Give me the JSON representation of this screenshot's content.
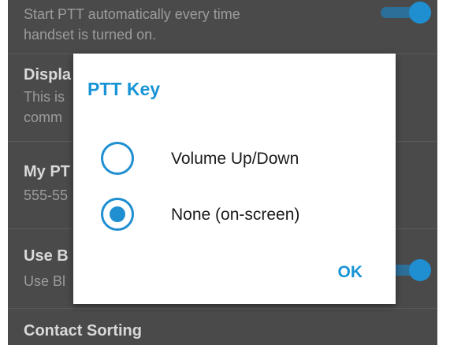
{
  "settings": {
    "auto_start": {
      "summary_line1": "Start PTT automatically every time",
      "summary_line2": "handset is turned on."
    },
    "display": {
      "title": "Displa",
      "summary_line1": "This is",
      "summary_line2": "comm"
    },
    "my_ptt": {
      "title": "My PT",
      "summary": "555-55"
    },
    "use_bluetooth": {
      "title": "Use B",
      "summary": "Use Bl"
    },
    "contact_sorting": {
      "title": "Contact Sorting"
    }
  },
  "dialog": {
    "title": "PTT Key",
    "options": [
      {
        "label": "Volume Up/Down",
        "selected": false
      },
      {
        "label": "None (on-screen)",
        "selected": true
      }
    ],
    "ok_label": "OK"
  },
  "colors": {
    "accent": "#1f8fd1",
    "background": "#4a4a4a"
  }
}
